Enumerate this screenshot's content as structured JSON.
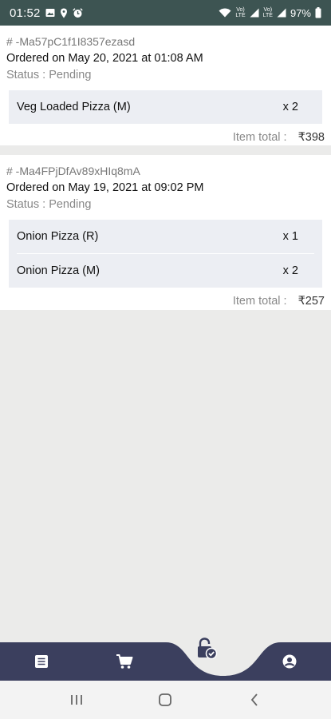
{
  "status_bar": {
    "time": "01:52",
    "battery": "97%",
    "icons_left": [
      "image-icon",
      "location-icon",
      "alarm-icon"
    ],
    "icons_right": [
      "wifi-icon",
      "volte-icon",
      "signal-icon",
      "volte-icon",
      "signal-icon",
      "battery-icon"
    ]
  },
  "orders": [
    {
      "id": "# -Ma57pC1f1I8357ezasd",
      "date": "Ordered on May 20, 2021 at 01:08 AM",
      "status": "Status : Pending",
      "items": [
        {
          "name": "Veg Loaded Pizza (M)",
          "qty": "x 2"
        }
      ],
      "total_label": "Item total :",
      "total_value": "₹398"
    },
    {
      "id": "# -Ma4FPjDfAv89xHIq8mA",
      "date": "Ordered on May 19, 2021 at 09:02 PM",
      "status": "Status : Pending",
      "items": [
        {
          "name": "Onion Pizza (R)",
          "qty": "x 1"
        },
        {
          "name": "Onion Pizza (M)",
          "qty": "x 2"
        }
      ],
      "total_label": "Item total :",
      "total_value": "₹257"
    }
  ],
  "bottom_nav": {
    "items": [
      "orders-list-icon",
      "cart-icon",
      "lock-check-icon",
      "profile-icon"
    ],
    "active": "lock-check-icon"
  },
  "system_nav": [
    "recents-button",
    "home-button",
    "back-button"
  ],
  "colors": {
    "status_bar": "#3d5452",
    "nav_bar": "#3b3f5e",
    "background": "#ebebea",
    "items_box": "#eceef3"
  }
}
